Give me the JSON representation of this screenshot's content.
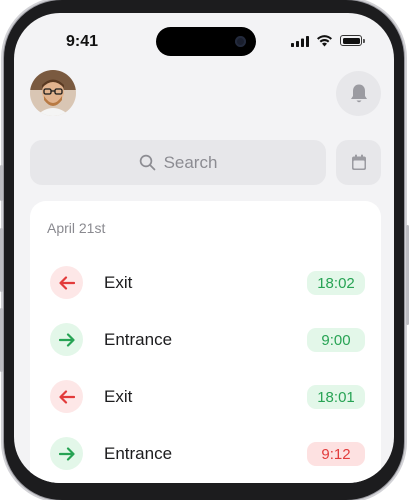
{
  "status_bar": {
    "time": "9:41"
  },
  "header": {
    "avatar_icon": "user-avatar",
    "notifications_icon": "bell-icon"
  },
  "search": {
    "placeholder": "Search",
    "icon": "search-icon"
  },
  "calendar_button": {
    "icon": "calendar-icon"
  },
  "activity": {
    "date": "April 21st",
    "entries": [
      {
        "type": "Exit",
        "time": "18:02",
        "direction": "arrow-left-icon",
        "status_color": "#27a354"
      },
      {
        "type": "Entrance",
        "time": "9:00",
        "direction": "arrow-right-icon",
        "status_color": "#27a354"
      },
      {
        "type": "Exit",
        "time": "18:01",
        "direction": "arrow-left-icon",
        "status_color": "#27a354"
      },
      {
        "type": "Entrance",
        "time": "9:12",
        "direction": "arrow-right-icon",
        "status_color": "#e23b3b"
      }
    ]
  },
  "colors": {
    "exit_accent": "#e23b3b",
    "entrance_accent": "#27a354",
    "late_accent": "#e23b3b"
  }
}
